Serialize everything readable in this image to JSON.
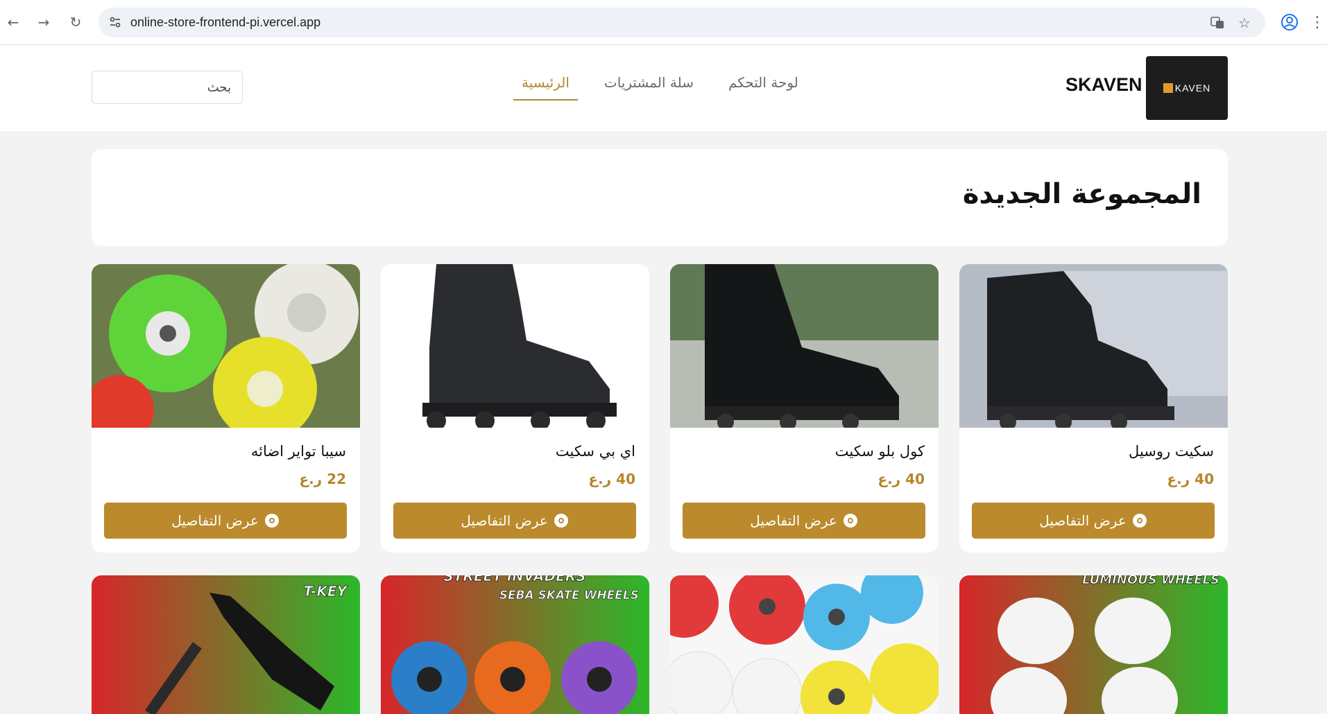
{
  "browser": {
    "url": "online-store-frontend-pi.vercel.app"
  },
  "header": {
    "search_placeholder": "بحث",
    "nav": [
      {
        "label": "الرئيسية",
        "active": true
      },
      {
        "label": "سلة المشتريات",
        "active": false
      },
      {
        "label": "لوحة التحكم",
        "active": false
      }
    ],
    "brand_name": "SKAVEN",
    "logo_text": "KAVEN"
  },
  "section": {
    "title": "المجموعة الجديدة"
  },
  "products": [
    {
      "name": "سكيت روسيل",
      "price": "40 ر.ع",
      "button": "عرض التفاصيل",
      "image": "black-skate-plastic"
    },
    {
      "name": "كول بلو سكيت",
      "price": "40 ر.ع",
      "button": "عرض التفاصيل",
      "image": "black-skate-park"
    },
    {
      "name": "اي بي سكيت",
      "price": "40 ر.ع",
      "button": "عرض التفاصيل",
      "image": "black-skate-white"
    },
    {
      "name": "سيبا تواير اضائه",
      "price": "22 ر.ع",
      "button": "عرض التفاصيل",
      "image": "colored-wheels"
    }
  ],
  "products_row2": [
    {
      "image": "luminous-wheels",
      "caption": "LUMINOUS WHEELS"
    },
    {
      "image": "heart-wheels",
      "caption": ""
    },
    {
      "image": "seba-skate-wheels",
      "caption": "SEBA SKATE WHEELS",
      "caption_top": "STREET INVADERS"
    },
    {
      "image": "t-key",
      "caption": "T-KEY"
    }
  ],
  "colors": {
    "accent": "#bb8a2c",
    "page_bg": "#f3f3f3",
    "logo_bg": "#1d1d1d"
  }
}
